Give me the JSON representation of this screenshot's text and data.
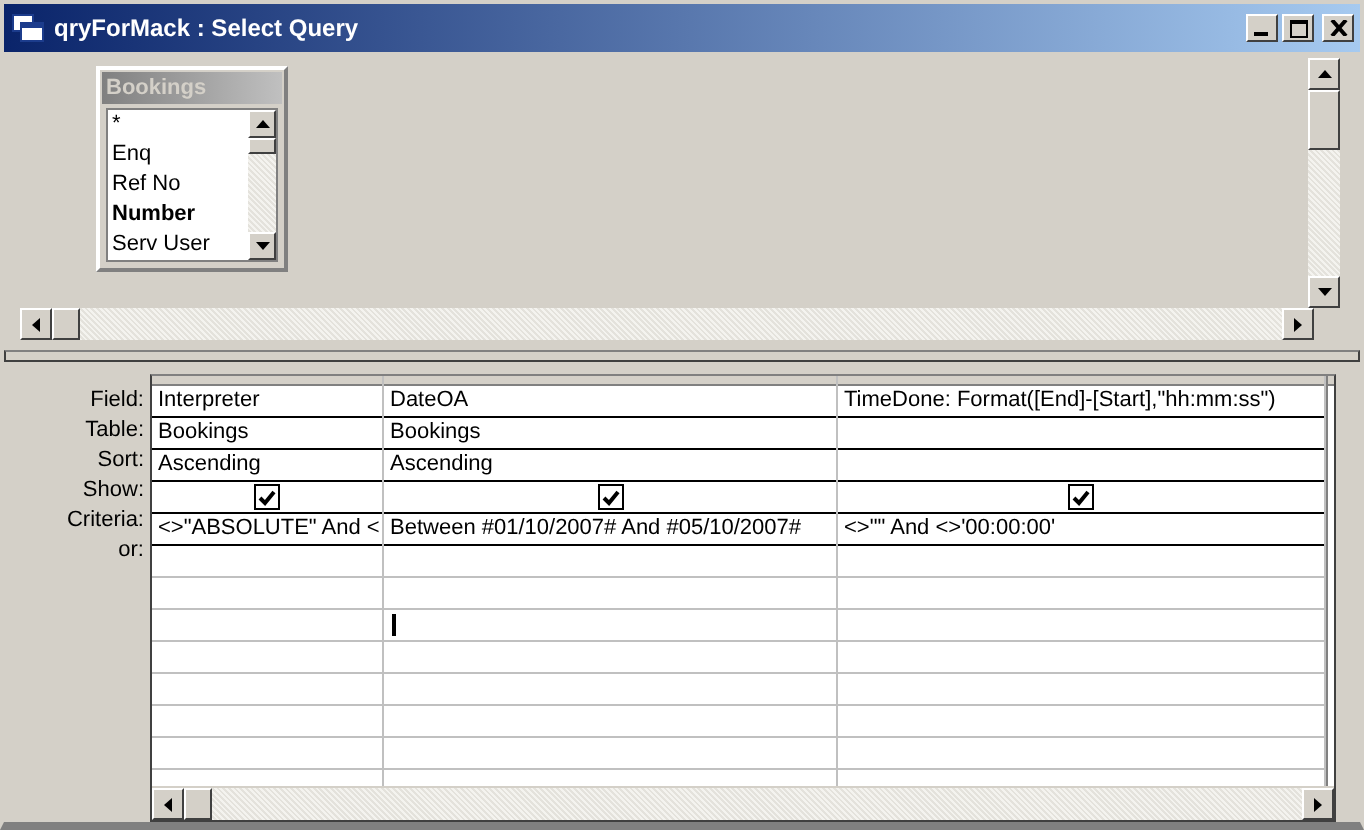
{
  "window": {
    "title": "qryForMack : Select Query"
  },
  "table_box": {
    "title": "Bookings",
    "fields": [
      {
        "name": "*",
        "primary_key": false
      },
      {
        "name": "Enq",
        "primary_key": false
      },
      {
        "name": "Ref No",
        "primary_key": false
      },
      {
        "name": "Number",
        "primary_key": true
      },
      {
        "name": "Serv User",
        "primary_key": false
      }
    ]
  },
  "grid": {
    "row_labels": [
      "Field:",
      "Table:",
      "Sort:",
      "Show:",
      "Criteria:",
      "or:"
    ],
    "columns": [
      {
        "field": "Interpreter",
        "table": "Bookings",
        "sort": "Ascending",
        "show": true,
        "criteria": "<>\"ABSOLUTE\" And <"
      },
      {
        "field": "DateOA",
        "table": "Bookings",
        "sort": "Ascending",
        "show": true,
        "criteria": "Between #01/10/2007# And #05/10/2007#"
      },
      {
        "field": "TimeDone: Format([End]-[Start],\"hh:mm:ss\")",
        "show": true,
        "criteria": "<>\"\" And <>'00:00:00'"
      }
    ]
  }
}
